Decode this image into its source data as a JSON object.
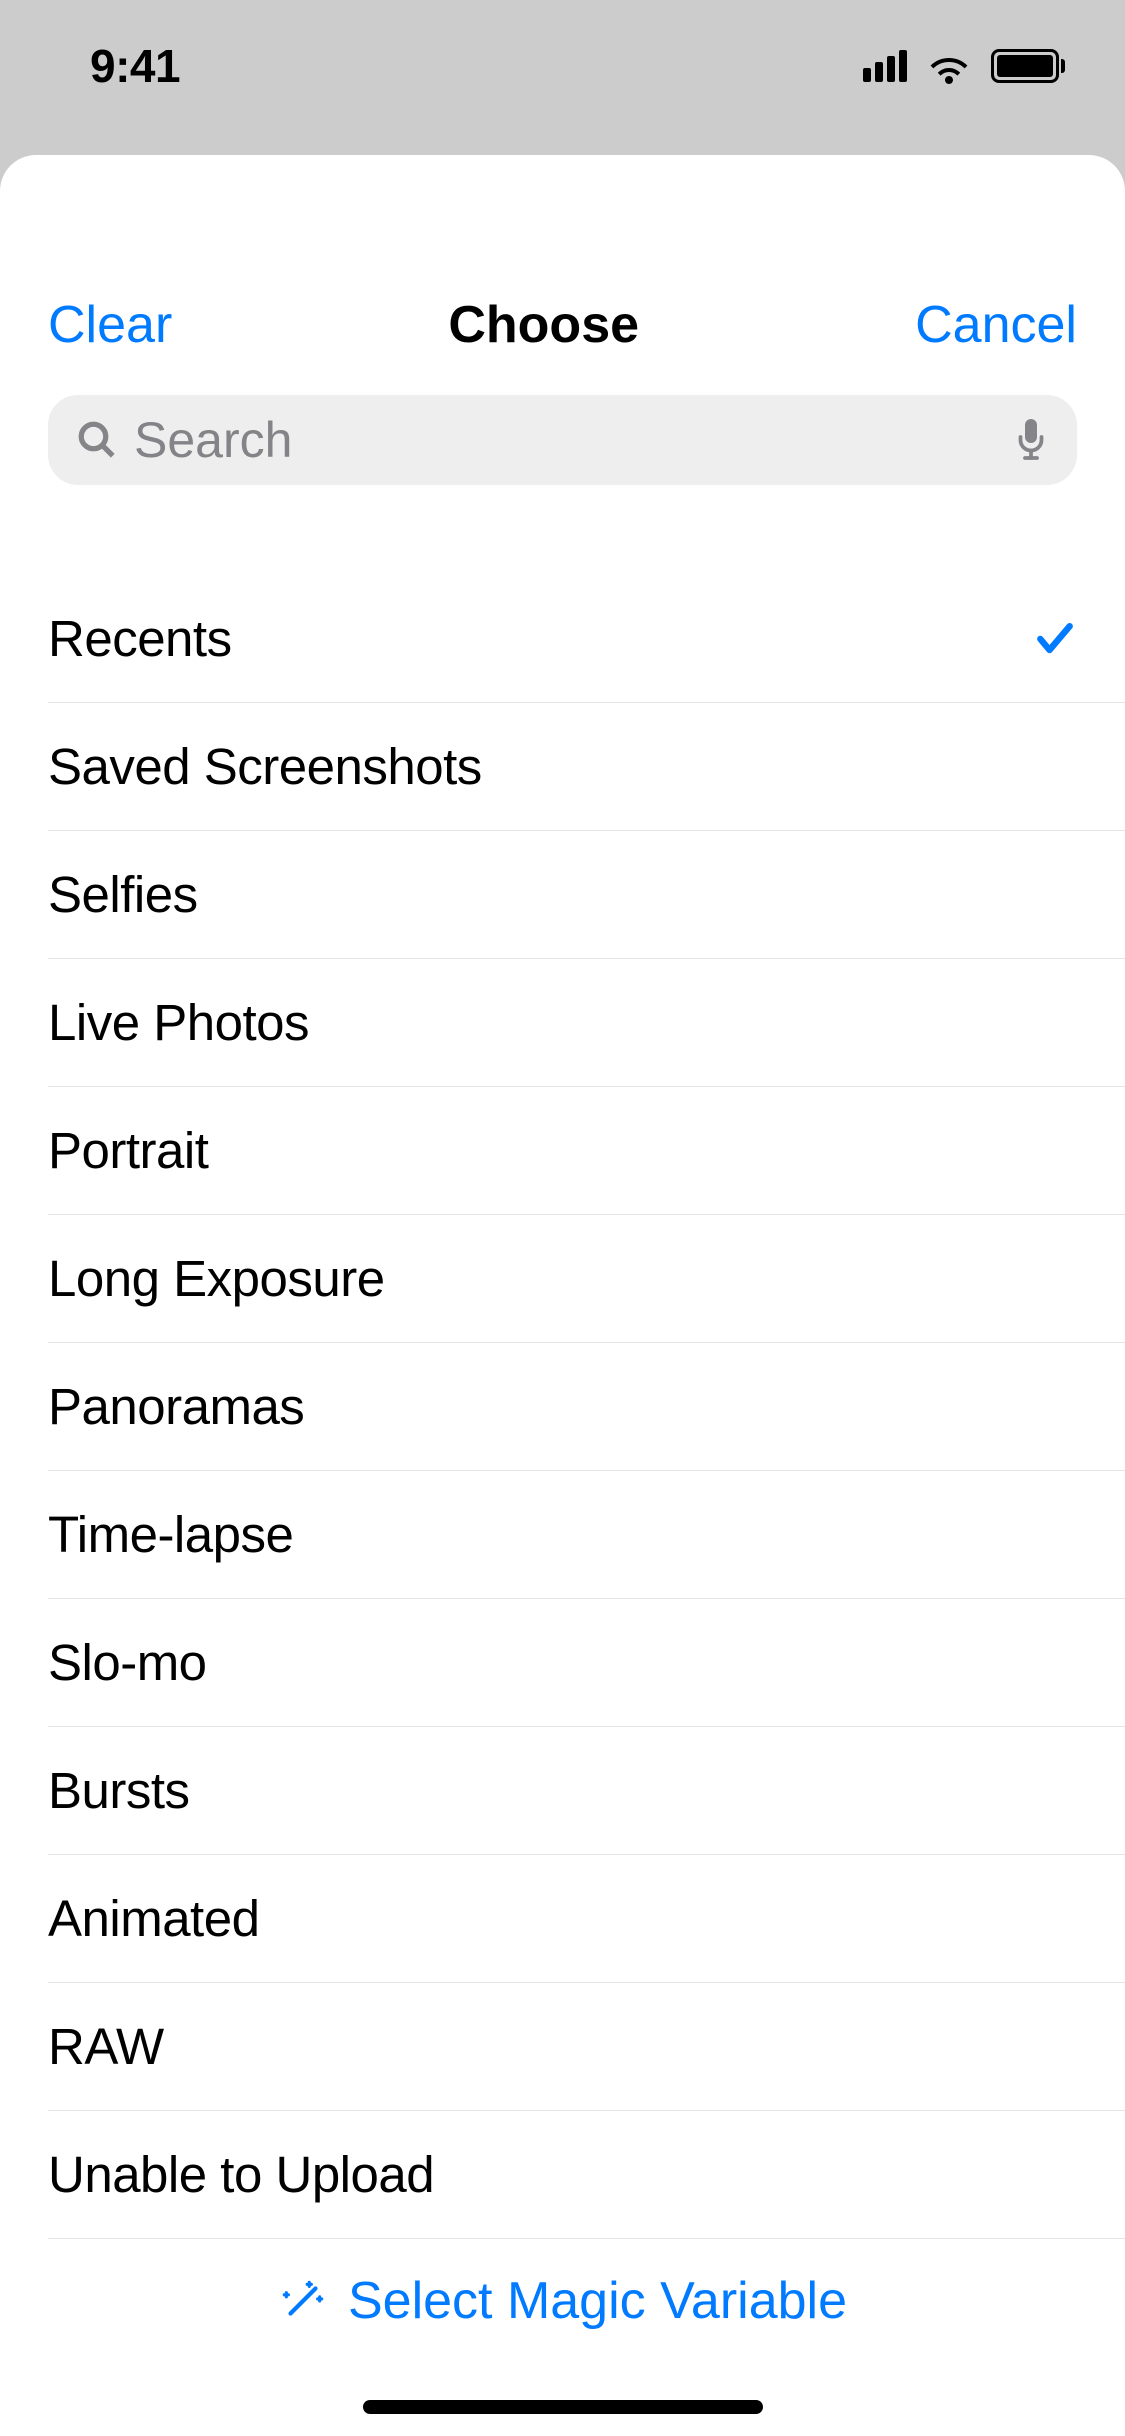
{
  "status": {
    "time": "9:41"
  },
  "nav": {
    "left": "Clear",
    "title": "Choose",
    "right": "Cancel"
  },
  "search": {
    "placeholder": "Search"
  },
  "items": [
    {
      "label": "Recents",
      "selected": true
    },
    {
      "label": "Saved Screenshots",
      "selected": false
    },
    {
      "label": "Selfies",
      "selected": false
    },
    {
      "label": "Live Photos",
      "selected": false
    },
    {
      "label": "Portrait",
      "selected": false
    },
    {
      "label": "Long Exposure",
      "selected": false
    },
    {
      "label": "Panoramas",
      "selected": false
    },
    {
      "label": "Time-lapse",
      "selected": false
    },
    {
      "label": "Slo-mo",
      "selected": false
    },
    {
      "label": "Bursts",
      "selected": false
    },
    {
      "label": "Animated",
      "selected": false
    },
    {
      "label": "RAW",
      "selected": false
    },
    {
      "label": "Unable to Upload",
      "selected": false
    }
  ],
  "footer": {
    "magic_variable_label": "Select Magic Variable"
  }
}
